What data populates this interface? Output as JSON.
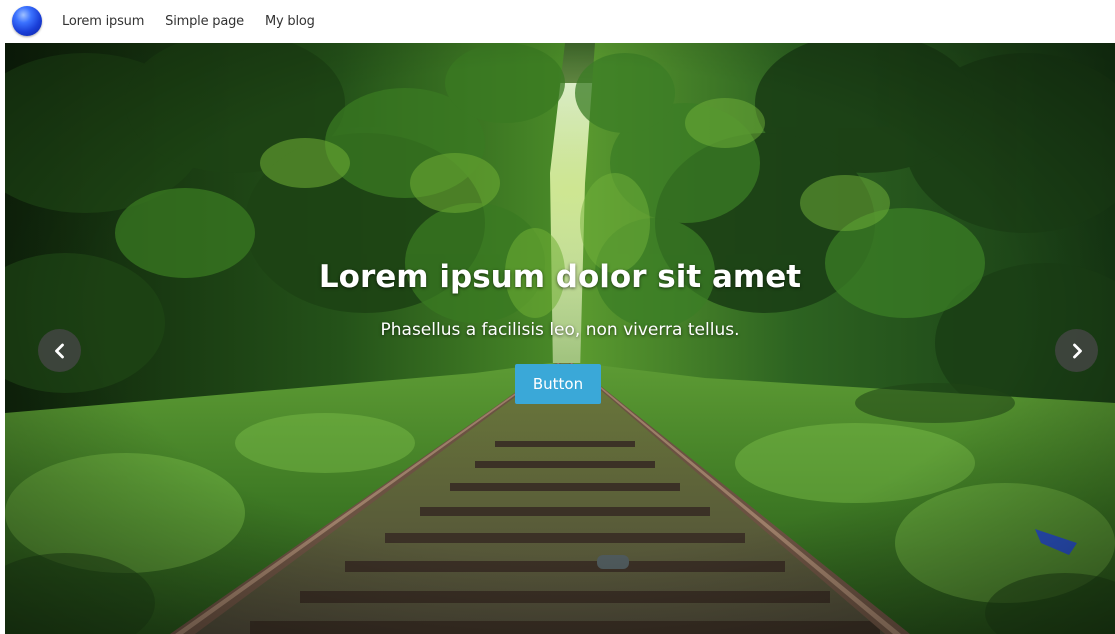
{
  "nav": {
    "links": [
      "Lorem ipsum",
      "Simple page",
      "My blog"
    ]
  },
  "hero": {
    "title": "Lorem ipsum dolor sit amet",
    "subtitle": "Phasellus a facilisis leo, non viverra tellus.",
    "button_label": "Button"
  },
  "icons": {
    "logo": "blue-sphere-logo",
    "prev": "chevron-left-icon",
    "next": "chevron-right-icon"
  },
  "colors": {
    "button": "#3aa8d8",
    "arrow_bg": "#464646",
    "logo": "#1a3fd8"
  }
}
